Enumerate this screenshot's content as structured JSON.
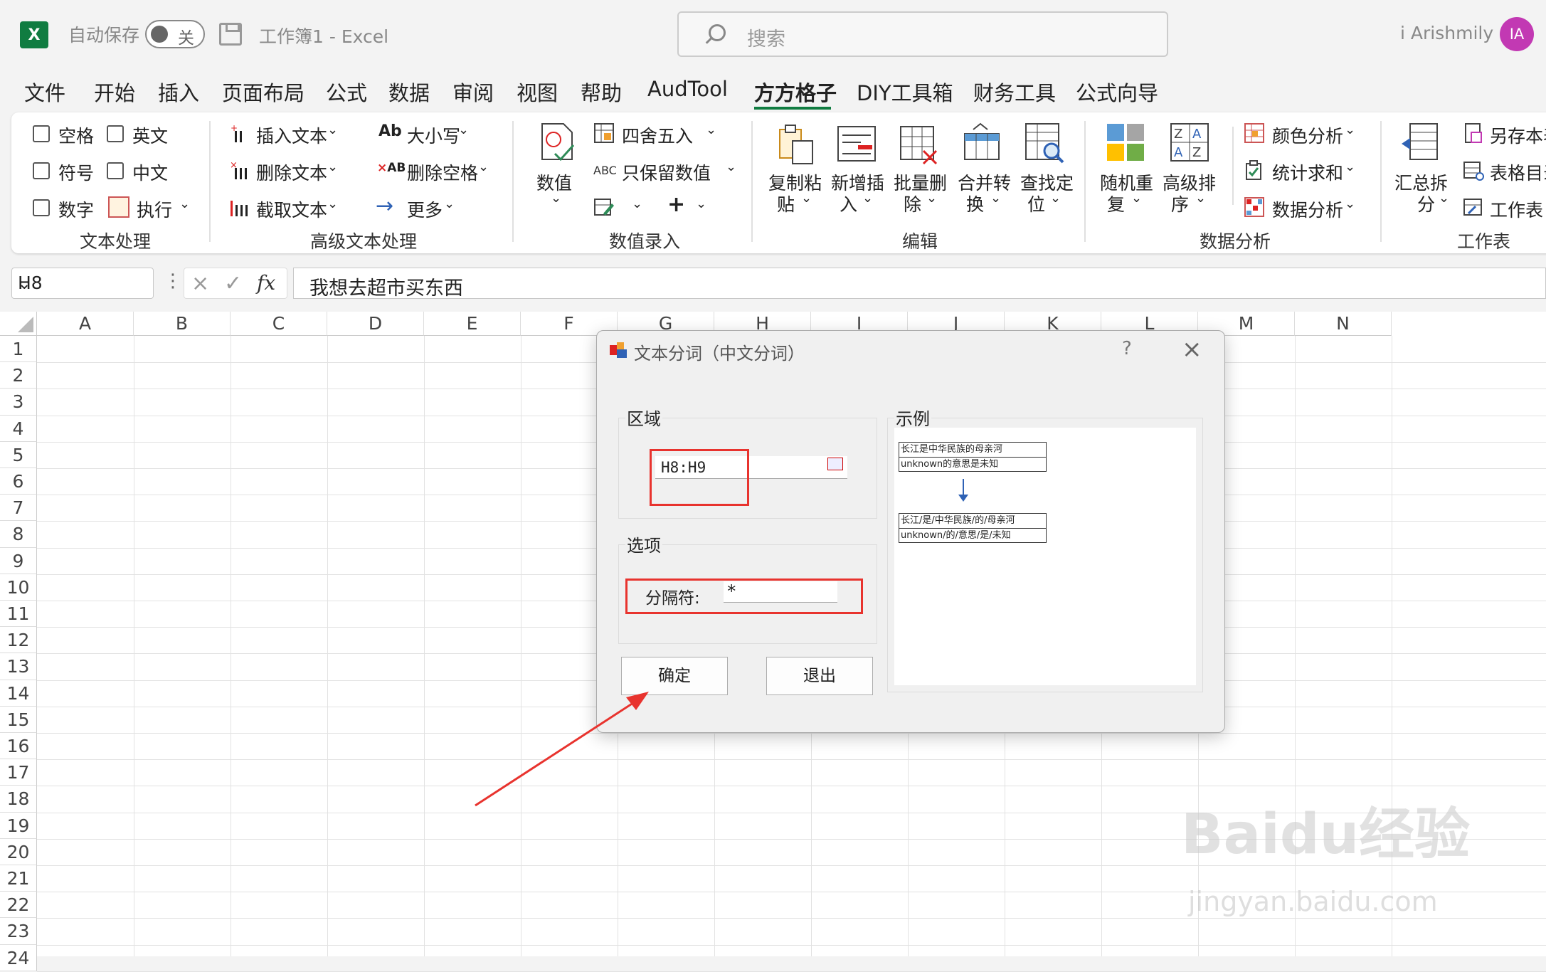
{
  "titlebar": {
    "app_icon": "excel-icon",
    "autosave_label": "自动保存",
    "autosave_state": "关",
    "doc_title": "工作簿1  -  Excel",
    "search_placeholder": "搜索",
    "user_name": "i Arishmily",
    "avatar_initials": "IA"
  },
  "menu": [
    "文件",
    "开始",
    "插入",
    "页面布局",
    "公式",
    "数据",
    "审阅",
    "视图",
    "帮助",
    "AudTool",
    "方方格子",
    "DIY工具箱",
    "财务工具",
    "公式向导"
  ],
  "menu_active": "方方格子",
  "ribbon": {
    "text_processing": {
      "label": "文本处理",
      "checkboxes": [
        "空格",
        "英文",
        "符号",
        "中文",
        "数字"
      ],
      "execute": "执行"
    },
    "adv_text": {
      "label": "高级文本处理",
      "insert_text": "插入文本",
      "delete_text": "删除文本",
      "cut_text": "截取文本",
      "case": "大小写",
      "delete_space": "删除空格",
      "more": "更多"
    },
    "num_entry": {
      "label": "数值录入",
      "value": "数值",
      "round": "四舍五入",
      "keep_numbers": "只保留数值",
      "abc": "ABC"
    },
    "edit": {
      "label": "编辑",
      "copy_paste": [
        "复制粘",
        "贴"
      ],
      "new_insert": [
        "新增插",
        "入"
      ],
      "batch_delete": [
        "批量删",
        "除"
      ],
      "merge_convert": [
        "合并转",
        "换"
      ],
      "find_locate": [
        "查找定",
        "位"
      ]
    },
    "data_analysis": {
      "label": "数据分析",
      "random_repeat": [
        "随机重",
        "复"
      ],
      "advanced_sort": [
        "高级排",
        "序"
      ],
      "color_analysis": "颜色分析",
      "stat_sum": "统计求和",
      "data_analysis": "数据分析"
    },
    "worksheet": {
      "label": "工作表",
      "summary_split": [
        "汇总拆",
        "分"
      ],
      "save_as": "另存本表",
      "toc": "表格目录",
      "worksheet": "工作表"
    }
  },
  "formula_bar": {
    "name_box": "H8",
    "content": "我想去超市买东西"
  },
  "grid": {
    "columns": [
      "A",
      "B",
      "C",
      "D",
      "E",
      "F",
      "G",
      "H",
      "I",
      "J",
      "K",
      "L",
      "M",
      "N"
    ],
    "rows": [
      "1",
      "2",
      "3",
      "4",
      "5",
      "6",
      "7",
      "8",
      "9",
      "10",
      "11",
      "12",
      "13",
      "14",
      "15",
      "16",
      "17",
      "18",
      "19",
      "20",
      "21",
      "22",
      "23",
      "24"
    ]
  },
  "dialog": {
    "title": "文本分词（中文分词）",
    "help": "?",
    "region_legend": "区域",
    "region_value": "H8:H9",
    "options_legend": "选项",
    "separator_label": "分隔符:",
    "separator_value": "*",
    "example_legend": "示例",
    "example_before": [
      "长江是中华民族的母亲河",
      "unknown的意思是未知"
    ],
    "example_after": [
      "长江/是/中华民族/的/母亲河",
      "unknown/的/意思/是/未知"
    ],
    "ok_button": "确定",
    "exit_button": "退出"
  },
  "watermark": {
    "main": "Baidu经验",
    "url": "jingyan.baidu.com"
  },
  "colors": {
    "excel_green": "#107c41",
    "annotation_red": "#e8332e",
    "avatar": "#c239b3"
  }
}
